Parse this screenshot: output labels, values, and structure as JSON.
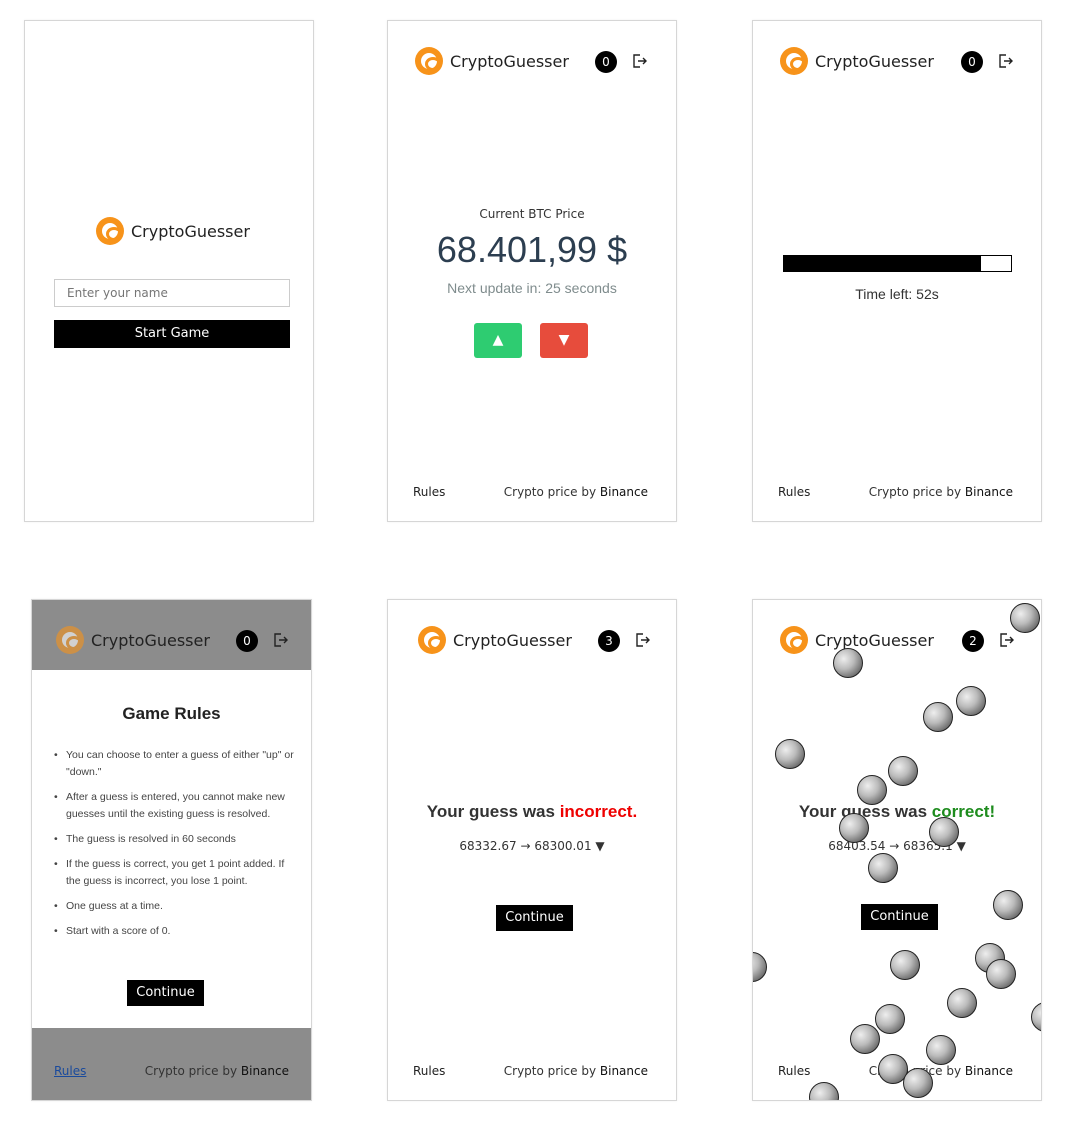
{
  "app": {
    "name": "CryptoGuesser"
  },
  "screens": {
    "start": {
      "name_placeholder": "Enter your name",
      "start_button": "Start Game"
    },
    "guess": {
      "score": "0",
      "price_label": "Current BTC Price",
      "price": "68.401,99 $",
      "next_update": "Next update in: 25 seconds",
      "up_button": "▲",
      "down_button": "▼"
    },
    "waiting": {
      "score": "0",
      "time_left": "Time left: 52s",
      "progress_fraction": 0.87
    },
    "rules": {
      "score": "0",
      "title": "Game Rules",
      "items": [
        "You can choose to enter a guess of either \"up\" or \"down.\"",
        "After a guess is entered, you cannot make new guesses until the existing guess is resolved.",
        "The guess is resolved in 60 seconds",
        "If the guess is correct, you get 1 point added. If the guess is incorrect, you lose 1 point.",
        "One guess at a time.",
        "Start with a score of 0."
      ],
      "continue_button": "Continue"
    },
    "incorrect": {
      "score": "3",
      "result_prefix": "Your guess was ",
      "result_word": "incorrect.",
      "change": "68332.67 → 68300.01 ▼",
      "continue_button": "Continue"
    },
    "correct": {
      "score": "2",
      "result_prefix": "Your guess was ",
      "result_word": "correct!",
      "change": "68403.54 → 68365.1 ▼",
      "continue_button": "Continue"
    }
  },
  "footer": {
    "rules_link": "Rules",
    "credit_prefix": "Crypto price by ",
    "credit_brand": "Binance"
  },
  "colors": {
    "brand_orange": "#f7931a",
    "up_green": "#2ecc71",
    "down_red": "#e74c3c",
    "incorrect_red": "#e00000",
    "correct_green": "#1e8c1e"
  }
}
